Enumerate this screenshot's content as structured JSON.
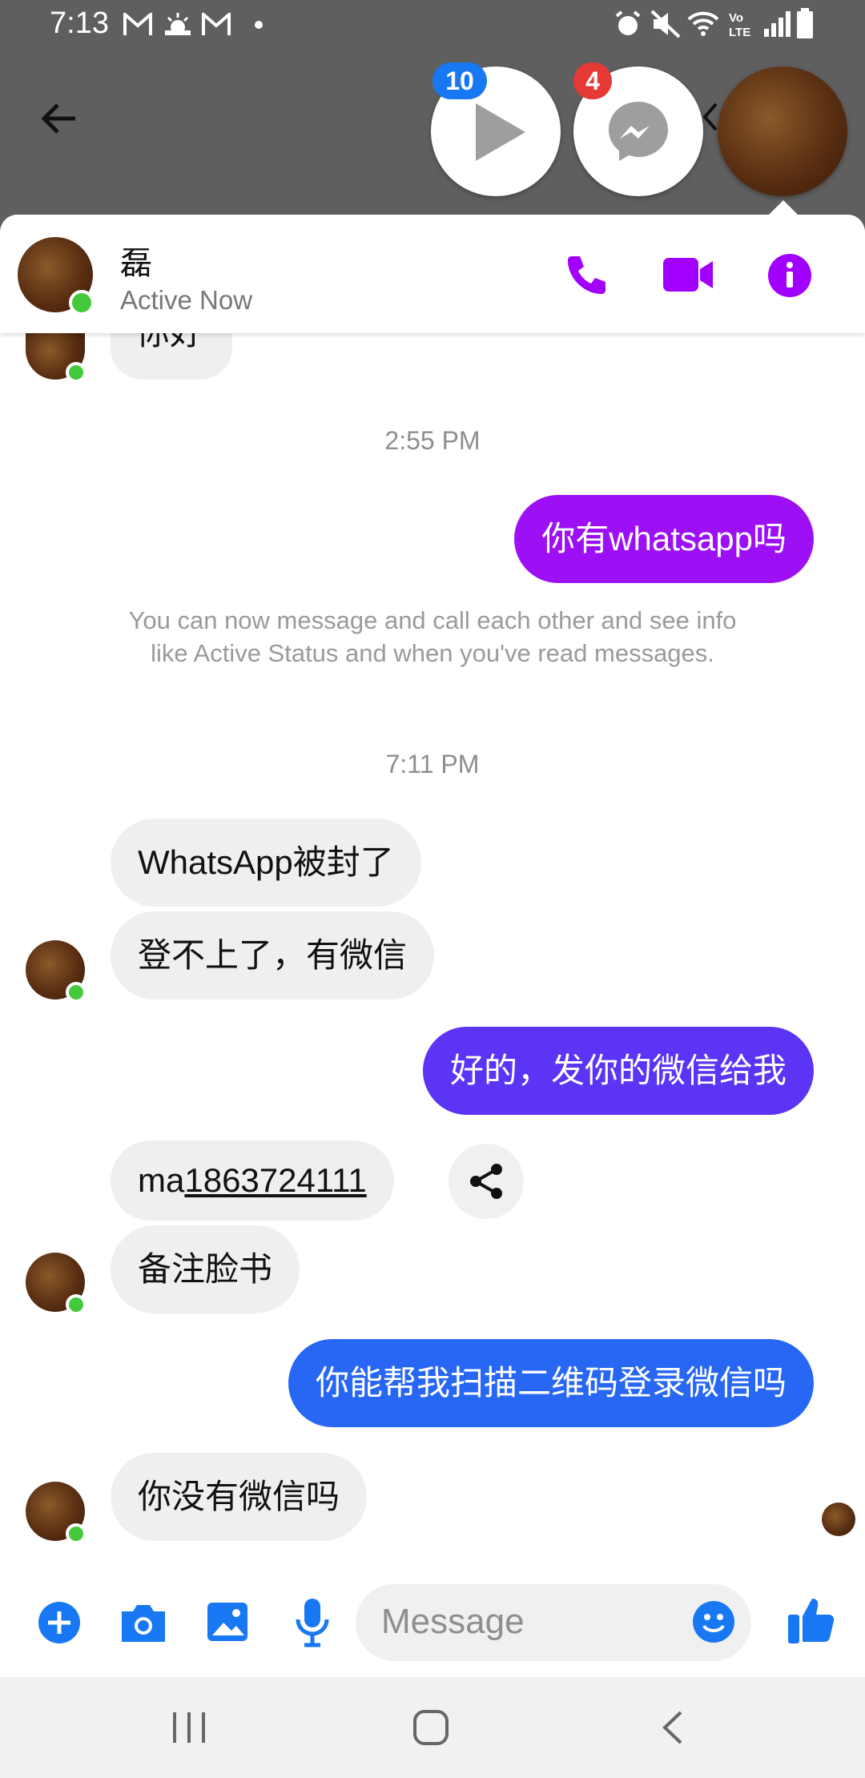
{
  "status_bar": {
    "time": "7:13"
  },
  "chat_heads": [
    {
      "badge": "10",
      "badge_color": "#1877f2"
    },
    {
      "badge": "4",
      "badge_color": "#e53935"
    }
  ],
  "header": {
    "name": "磊",
    "status": "Active Now"
  },
  "messages": {
    "first_partial": "你好",
    "time1": "2:55 PM",
    "out1": "你有whatsapp吗",
    "system_notice": "You can now message and call each other and see info like Active Status and when you've read messages.",
    "time2": "7:11 PM",
    "in1": "WhatsApp被封了",
    "in2": "登不上了，有微信",
    "out2": "好的，发你的微信给我",
    "in3_prefix": "ma",
    "in3_link": "1863724111",
    "in4": "备注脸书",
    "out3": "你能帮我扫描二维码登录微信吗",
    "in5": "你没有微信吗"
  },
  "composer": {
    "placeholder": "Message"
  },
  "colors": {
    "accent": "#a100ff",
    "out1": "#9d10f6",
    "out2": "#5b34f5",
    "out3": "#2767f4",
    "blue_icons": "#1877f2"
  }
}
